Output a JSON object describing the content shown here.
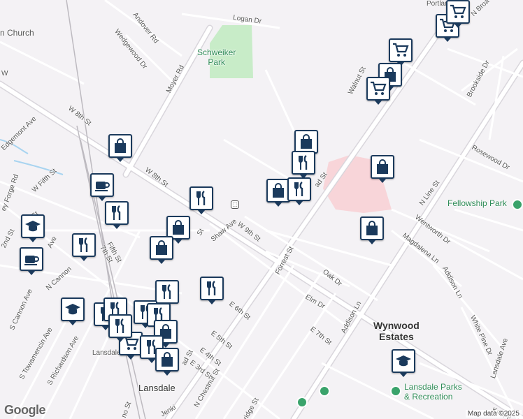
{
  "map": {
    "attribution": "Map data ©2025",
    "logo": "Google",
    "labels": {
      "church": "n Church",
      "logan": "Logan Dr",
      "andover": "Andover Rd",
      "wedgewood": "Wedgewood Dr",
      "moyer": "Moyer Rd",
      "w8th_a": "W 8th St",
      "w8th_b": "W 8th St",
      "edgemont": "Edgemont Ave",
      "fifth": "W Fifth St",
      "valleyforge": "ey Forge Rd",
      "fifth_ave": "Fifth St",
      "w9th_part": "9",
      "shaw": "Shaw Ave",
      "w9th": "W 9th St",
      "ncannon": "N Cannon",
      "scannon": "S Cannon Ave",
      "stowamencin": "S Towamencin Ave",
      "srichardson": "S Richardson Ave",
      "lansdale_small": "Lansdale",
      "lansdale": "Lansdale",
      "e6th": "E 6th St",
      "e5th": "E 5th St",
      "e4th": "E 4th St",
      "e3rd": "E 3rd St",
      "nchestnut": "N Chestnut St",
      "forrest": "Forrest St",
      "oak": "Oak Dr",
      "elm": "Elm Dr",
      "addison": "Addison Ln",
      "addison2": "Addison Ln",
      "e7th": "E 7th St",
      "wentworth": "Wentworth Dr",
      "magdalena": "Magdalena Ln",
      "whitepine": "White Pine Dr",
      "lansdale_ave": "Lansdale Ave",
      "nline": "N Line St",
      "rosewood": "Rosewood Dr",
      "brookside": "Brookside Dr",
      "walnut": "Walnut St",
      "broad_n": "N Broa",
      "broad_mid": "ad St",
      "broad_s": "ad St",
      "portland": "Portland",
      "knapp": "Knapp",
      "w2nd": "2nd St",
      "w3rd": "3rd St",
      "jenkins": "Jenki",
      "bridge": "ridge St",
      "s5th": "no St",
      "street_st": "St",
      "w7th": "7th St",
      "ave2": "Ave",
      "w_partial": "W"
    },
    "parks": {
      "schweiker": "Schweiker\nPark",
      "fellowship": "Fellowship Park",
      "recreation": "Lansdale Parks\n& Recreation"
    },
    "areas": {
      "wynwood": "Wynwood\nEstates"
    },
    "pins": [
      {
        "type": "shopping-cart"
      },
      {
        "type": "shopping-cart"
      },
      {
        "type": "shopping-cart"
      },
      {
        "type": "shopping-bag"
      },
      {
        "type": "shopping-cart"
      },
      {
        "type": "shopping-bag"
      },
      {
        "type": "restaurant"
      },
      {
        "type": "shopping-bag"
      },
      {
        "type": "restaurant"
      },
      {
        "type": "shopping-bag"
      },
      {
        "type": "shopping-bag"
      },
      {
        "type": "shopping-bag"
      },
      {
        "type": "cafe"
      },
      {
        "type": "restaurant"
      },
      {
        "type": "restaurant"
      },
      {
        "type": "shopping-bag"
      },
      {
        "type": "shopping-bag"
      },
      {
        "type": "school"
      },
      {
        "type": "restaurant"
      },
      {
        "type": "cafe"
      },
      {
        "type": "restaurant"
      },
      {
        "type": "restaurant"
      },
      {
        "type": "school"
      },
      {
        "type": "restaurant"
      },
      {
        "type": "restaurant"
      },
      {
        "type": "restaurant"
      },
      {
        "type": "restaurant"
      },
      {
        "type": "shopping-bag"
      },
      {
        "type": "shopping-cart"
      },
      {
        "type": "restaurant"
      },
      {
        "type": "restaurant"
      },
      {
        "type": "shopping-bag"
      },
      {
        "type": "school"
      }
    ],
    "colors": {
      "pin_border": "#1b3a5c",
      "park_green": "#c8ecc8",
      "road": "#ffffff",
      "road_outline": "#d9d6dc",
      "highlight": "#f8d5d9"
    }
  }
}
